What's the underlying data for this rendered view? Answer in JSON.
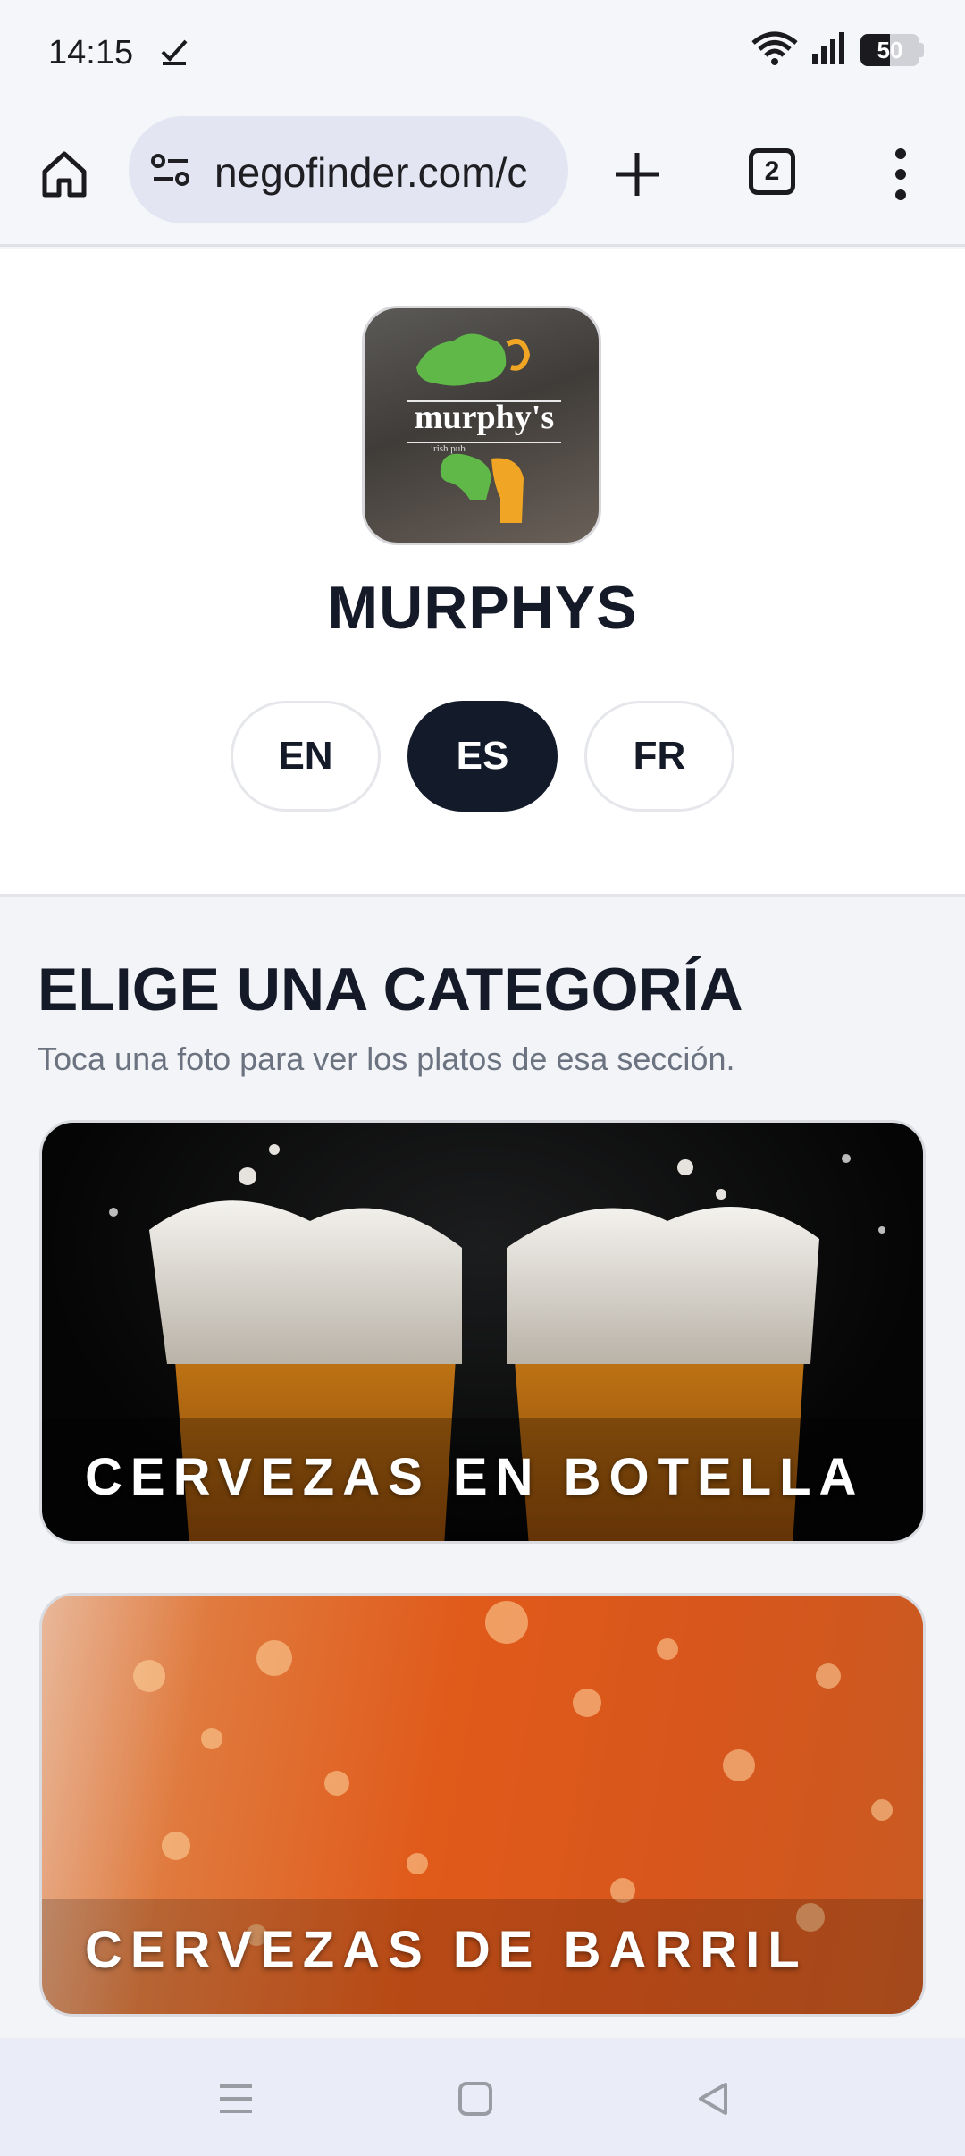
{
  "status_bar": {
    "time": "14:15",
    "battery": "50",
    "battery_level": 0.5
  },
  "browser": {
    "url": "negofinder.com/c",
    "tab_count": "2"
  },
  "business": {
    "name": "MURPHYS",
    "logo_text": "murphy's",
    "logo_subtext": "irish pub"
  },
  "languages": [
    {
      "code": "EN",
      "active": false
    },
    {
      "code": "ES",
      "active": true
    },
    {
      "code": "FR",
      "active": false
    }
  ],
  "categories_section": {
    "title": "ELIGE UNA CATEGORÍA",
    "subtitle": "Toca una foto para ver los platos de esa sección."
  },
  "categories": [
    {
      "label": "CERVEZAS EN BOTELLA"
    },
    {
      "label": "CERVEZAS DE BARRIL"
    }
  ],
  "colors": {
    "accent_dark": "#131a29",
    "logo_green": "#5fb848",
    "logo_orange": "#f0a624"
  },
  "icons": {
    "status": [
      "check-icon",
      "wifi-icon",
      "signal-icon",
      "battery-icon"
    ],
    "toolbar": [
      "home-icon",
      "site-settings-icon",
      "new-tab-icon",
      "tab-switcher-icon",
      "more-menu-icon"
    ],
    "nav": [
      "recents-icon",
      "home-nav-icon",
      "back-icon"
    ]
  }
}
